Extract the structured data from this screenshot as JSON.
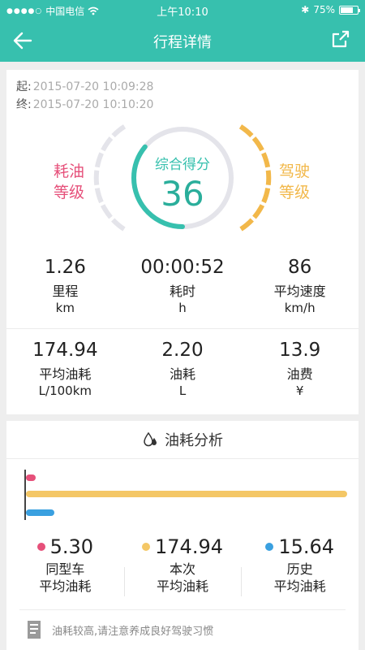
{
  "status": {
    "carrier": "中国电信",
    "time": "上午10:10",
    "battery": "75%",
    "battery_level": 0.75
  },
  "nav": {
    "title": "行程详情"
  },
  "trip": {
    "start_label": "起:",
    "start_time": "2015-07-20 10:09:28",
    "end_label": "终:",
    "end_time": "2015-07-20 10:10:20"
  },
  "gauge": {
    "left_label": "耗油\n等级",
    "right_label": "驾驶\n等级",
    "score_title": "综合得分",
    "score": "36",
    "score_fraction": 0.36,
    "colors": {
      "teal": "#37c0ae",
      "pink": "#e6507a",
      "yellow": "#f2b84a",
      "track": "#e4e4ea"
    }
  },
  "stats_row1": [
    {
      "value": "1.26",
      "label": "里程",
      "unit": "km"
    },
    {
      "value": "00:00:52",
      "label": "耗时",
      "unit": "h"
    },
    {
      "value": "86",
      "label": "平均速度",
      "unit": "km/h"
    }
  ],
  "stats_row2": [
    {
      "value": "174.94",
      "label": "平均油耗",
      "unit": "L/100km"
    },
    {
      "value": "2.20",
      "label": "油耗",
      "unit": "L"
    },
    {
      "value": "13.9",
      "label": "油费",
      "unit": "¥"
    }
  ],
  "analysis": {
    "title": "油耗分析",
    "bars_max": 174.94,
    "items": [
      {
        "value": "5.30",
        "num": 5.3,
        "label1": "同型车",
        "label2": "平均油耗",
        "color": "#e6507a"
      },
      {
        "value": "174.94",
        "num": 174.94,
        "label1": "本次",
        "label2": "平均油耗",
        "color": "#f4c766"
      },
      {
        "value": "15.64",
        "num": 15.64,
        "label1": "历史",
        "label2": "平均油耗",
        "color": "#3aa0e0"
      }
    ],
    "tip": "油耗较高,请注意养成良好驾驶习惯"
  }
}
